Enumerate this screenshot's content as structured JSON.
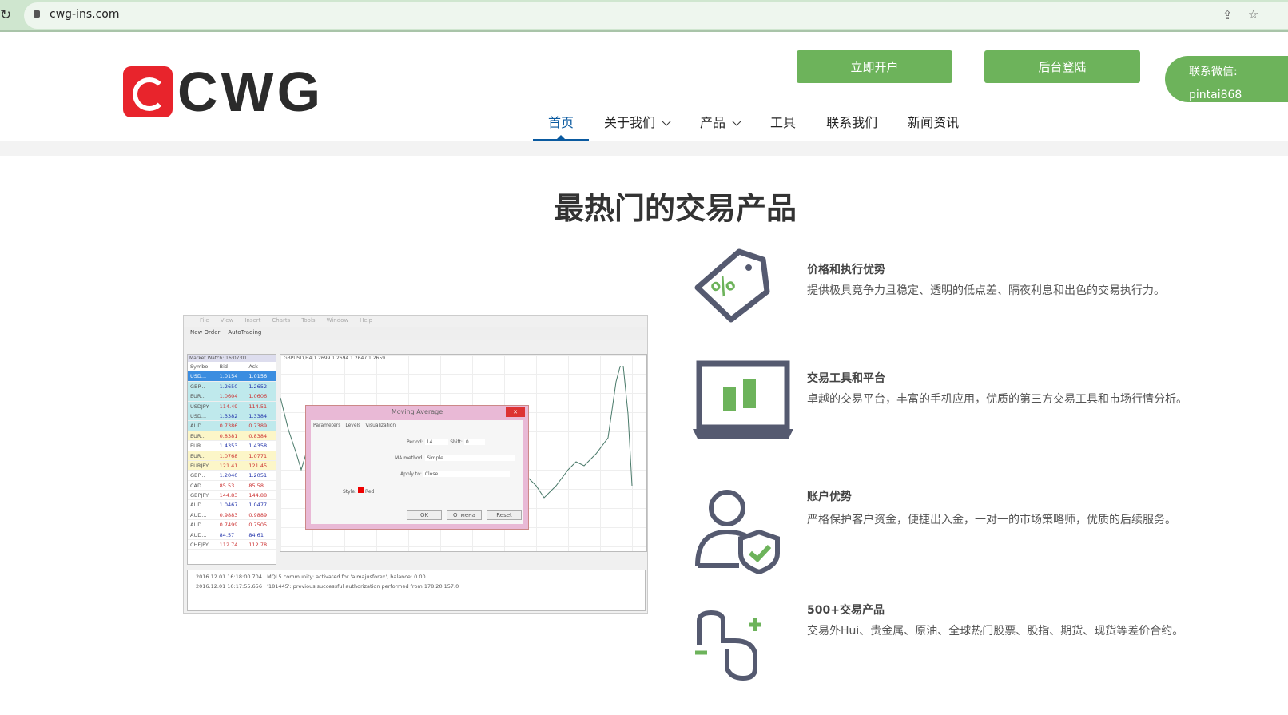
{
  "browser": {
    "url": "cwg-ins.com"
  },
  "header": {
    "logo": "CWG",
    "open_account": "立即开户",
    "login": "后台登陆",
    "wechat_label": "联系微信:",
    "wechat_id": "pintai868"
  },
  "nav": [
    {
      "label": "首页",
      "active": true
    },
    {
      "label": "关于我们",
      "dropdown": true
    },
    {
      "label": "产品",
      "dropdown": true
    },
    {
      "label": "工具"
    },
    {
      "label": "联系我们"
    },
    {
      "label": "新闻资讯"
    }
  ],
  "section_title": "最热门的交易产品",
  "platform": {
    "menu": [
      "File",
      "View",
      "Insert",
      "Charts",
      "Tools",
      "Window",
      "Help"
    ],
    "toolbar": [
      "New Order",
      "AutoTrading"
    ],
    "market_watch_title": "Market Watch: 16:07:01",
    "columns": [
      "Symbol",
      "Bid",
      "Ask"
    ],
    "rows": [
      [
        "USD...",
        "1.0154",
        "1.0156"
      ],
      [
        "GBP...",
        "1.2650",
        "1.2652"
      ],
      [
        "EUR...",
        "1.0604",
        "1.0606"
      ],
      [
        "USDJPY",
        "114.49",
        "114.51"
      ],
      [
        "USD...",
        "1.3382",
        "1.3384"
      ],
      [
        "AUD...",
        "0.7386",
        "0.7389"
      ],
      [
        "EUR...",
        "0.8381",
        "0.8384"
      ],
      [
        "EUR...",
        "1.4353",
        "1.4358"
      ],
      [
        "EUR...",
        "1.0768",
        "1.0771"
      ],
      [
        "EURJPY",
        "121.41",
        "121.45"
      ],
      [
        "GBP...",
        "1.2040",
        "1.2051"
      ],
      [
        "CAD...",
        "85.53",
        "85.58"
      ],
      [
        "GBPJPY",
        "144.83",
        "144.88"
      ],
      [
        "AUD...",
        "1.0467",
        "1.0477"
      ],
      [
        "AUD...",
        "0.9883",
        "0.9889"
      ],
      [
        "AUD...",
        "0.7499",
        "0.7505"
      ],
      [
        "AUD...",
        "84.57",
        "84.61"
      ],
      [
        "CHFJPY",
        "112.74",
        "112.78"
      ]
    ],
    "chart_label": "GBPUSD,H4 1.2699 1.2694 1.2647 1.2659",
    "dialog": {
      "title": "Moving Average",
      "tabs": [
        "Parameters",
        "Levels",
        "Visualization"
      ],
      "period_label": "Period:",
      "period": "14",
      "shift_label": "Shift:",
      "shift": "0",
      "method_label": "MA method:",
      "method": "Simple",
      "apply_label": "Apply to:",
      "apply": "Close",
      "style_label": "Style:",
      "style": "Red",
      "ok": "OK",
      "cancel": "Отмена",
      "reset": "Reset"
    },
    "journal": [
      [
        "2016.12.01 16:18:00.704",
        "MQL5.community: activated for 'aimajusforex', balance: 0.00"
      ],
      [
        "2016.12.01 16:17:55.656",
        "'181445': previous successful authorization performed from 178.20.157.0"
      ]
    ]
  },
  "features": [
    {
      "title": "价格和执行优势",
      "desc": "提供极具竞争力且稳定、透明的低点差、隔夜利息和出色的交易执行力。"
    },
    {
      "title": "交易工具和平台",
      "desc": "卓越的交易平台，丰富的手机应用，优质的第三方交易工具和市场行情分析。"
    },
    {
      "title": "账户优势",
      "desc": "严格保护客户资金，便捷出入金，一对一的市场策略师，优质的后续服务。"
    },
    {
      "title": "500+交易产品",
      "desc": "交易外Hui、贵金属、原油、全球热门股票、股指、期货、现货等差价合约。"
    }
  ],
  "colors": {
    "accent": "#6db35b",
    "nav_active": "#0a5aa0",
    "logo_red": "#e8242c"
  }
}
